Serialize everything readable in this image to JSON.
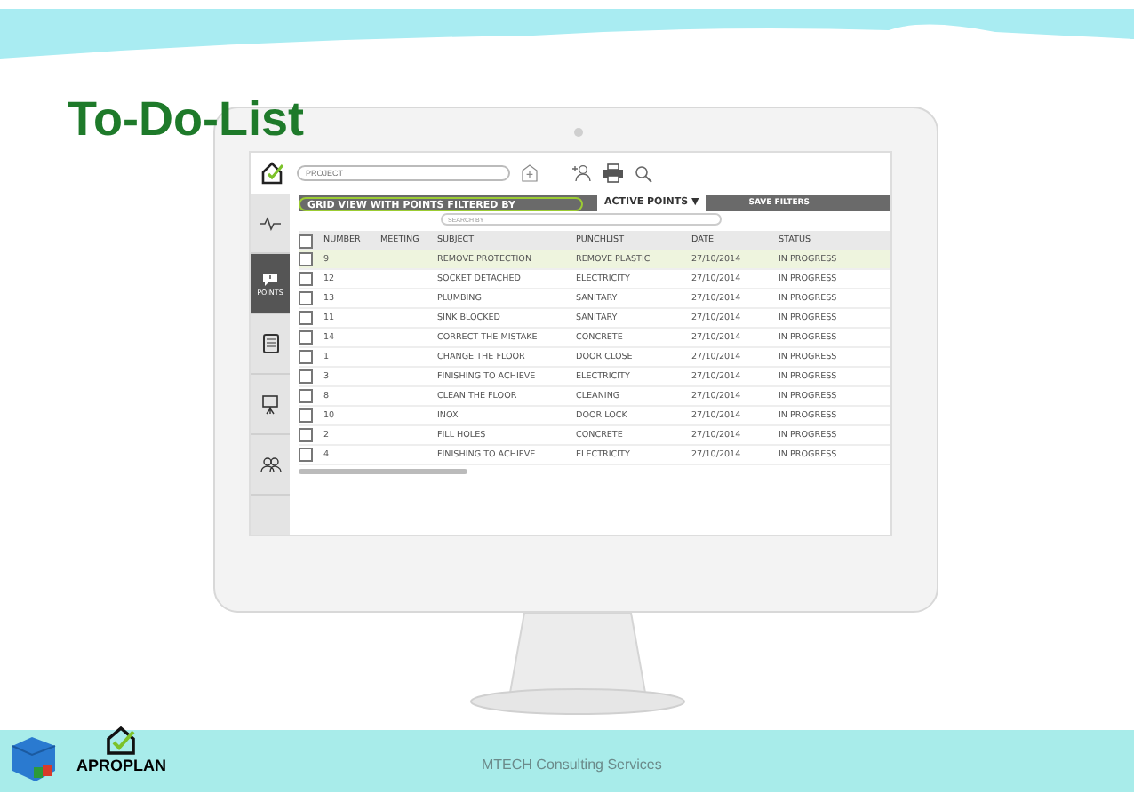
{
  "slide_title": "To-Do-List",
  "app": {
    "project_field": {
      "placeholder": "PROJECT"
    },
    "filter_label": "GRID VIEW WITH POINTS FILTERED BY",
    "filter_value": "ACTIVE POINTS ▼",
    "save_filters": "SAVE FILTERS",
    "search": {
      "placeholder": "SEARCH BY"
    },
    "sidebar": [
      {
        "kind": "pulse",
        "selected": false
      },
      {
        "kind": "points",
        "label": "POINTS",
        "selected": true
      },
      {
        "kind": "list",
        "selected": false
      },
      {
        "kind": "board",
        "selected": false
      },
      {
        "kind": "people",
        "selected": false
      }
    ],
    "select_all_checked": false,
    "columns": [
      "NUMBER",
      "MEETING",
      "SUBJECT",
      "PUNCHLIST",
      "DATE",
      "STATUS"
    ],
    "rows": [
      {
        "cells": [
          "9",
          "",
          "REMOVE PROTECTION",
          "REMOVE PLASTIC",
          "27/10/2014",
          "IN PROGRESS"
        ],
        "checked": false,
        "selected": true
      },
      {
        "cells": [
          "12",
          "",
          "SOCKET DETACHED",
          "ELECTRICITY",
          "27/10/2014",
          "IN PROGRESS"
        ],
        "checked": false,
        "selected": false
      },
      {
        "cells": [
          "13",
          "",
          "PLUMBING",
          "SANITARY",
          "27/10/2014",
          "IN PROGRESS"
        ],
        "checked": false,
        "selected": false
      },
      {
        "cells": [
          "11",
          "",
          "SINK BLOCKED",
          "SANITARY",
          "27/10/2014",
          "IN PROGRESS"
        ],
        "checked": false,
        "selected": false
      },
      {
        "cells": [
          "14",
          "",
          "CORRECT THE MISTAKE",
          "CONCRETE",
          "27/10/2014",
          "IN PROGRESS"
        ],
        "checked": false,
        "selected": false
      },
      {
        "cells": [
          "1",
          "",
          "CHANGE THE FLOOR",
          "DOOR CLOSE",
          "27/10/2014",
          "IN PROGRESS"
        ],
        "checked": false,
        "selected": false
      },
      {
        "cells": [
          "3",
          "",
          "FINISHING TO ACHIEVE",
          "ELECTRICITY",
          "27/10/2014",
          "IN PROGRESS"
        ],
        "checked": false,
        "selected": false
      },
      {
        "cells": [
          "8",
          "",
          "CLEAN THE FLOOR",
          "CLEANING",
          "27/10/2014",
          "IN PROGRESS"
        ],
        "checked": false,
        "selected": false
      },
      {
        "cells": [
          "10",
          "",
          "INOX",
          "DOOR LOCK",
          "27/10/2014",
          "IN PROGRESS"
        ],
        "checked": false,
        "selected": false
      },
      {
        "cells": [
          "2",
          "",
          "FILL HOLES",
          "CONCRETE",
          "27/10/2014",
          "IN PROGRESS"
        ],
        "checked": false,
        "selected": false
      },
      {
        "cells": [
          "4",
          "",
          "FINISHING TO ACHIEVE",
          "ELECTRICITY",
          "27/10/2014",
          "IN PROGRESS"
        ],
        "checked": false,
        "selected": false
      }
    ]
  },
  "footer": {
    "brand": "APROPLAN",
    "text": "MTECH Consulting Services"
  }
}
